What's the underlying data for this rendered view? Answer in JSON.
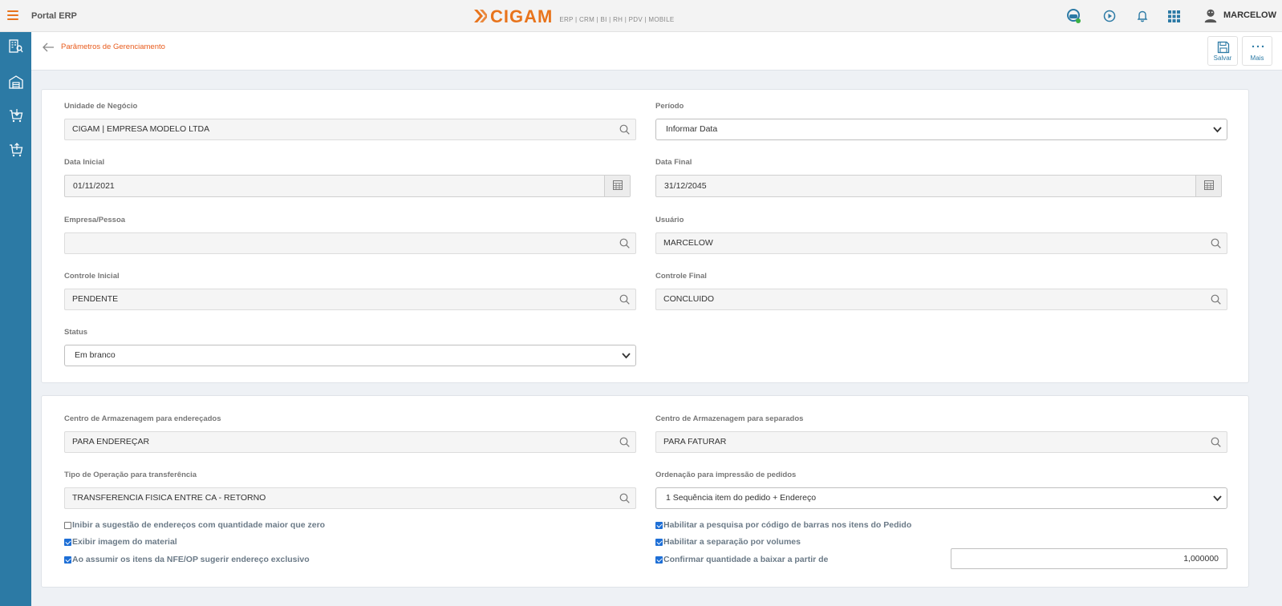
{
  "topbar": {
    "app_title": "Portal ERP",
    "logo_text": "CIGAM",
    "logo_sub": "ERP | CRM | BI | RH | PDV | MOBILE",
    "user_name": "MARCELOW",
    "brand_color": "#e8741c"
  },
  "sidebar": {
    "color": "#2c7aa5"
  },
  "header": {
    "page_title": "Parâmetros de Gerenciamento",
    "save_label": "Salvar",
    "more_label": "Mais"
  },
  "filters": {
    "unidade_label": "Unidade de Negócio",
    "unidade_value": "CIGAM | EMPRESA MODELO LTDA",
    "periodo_label": "Período",
    "periodo_value": "Informar Data",
    "data_inicial_label": "Data Inicial",
    "data_inicial_value": "01/11/2021",
    "data_final_label": "Data Final",
    "data_final_value": "31/12/2045",
    "empresa_label": "Empresa/Pessoa",
    "empresa_value": "",
    "usuario_label": "Usuário",
    "usuario_value": "MARCELOW",
    "controle_inicial_label": "Controle Inicial",
    "controle_inicial_value": "PENDENTE",
    "controle_final_label": "Controle Final",
    "controle_final_value": "CONCLUIDO",
    "status_label": "Status",
    "status_value": "Em branco"
  },
  "settings": {
    "centro_enderecados_label": "Centro de Armazenagem para endereçados",
    "centro_enderecados_value": "PARA ENDEREÇAR",
    "centro_separados_label": "Centro de Armazenagem para separados",
    "centro_separados_value": "PARA FATURAR",
    "tipo_operacao_label": "Tipo de Operação para transferência",
    "tipo_operacao_value": "TRANSFERENCIA FISICA ENTRE CA - RETORNO",
    "ordenacao_label": "Ordenação para impressão de pedidos",
    "ordenacao_value": "1 Sequência item do pedido + Endereço",
    "checks": [
      {
        "label": "Inibir a sugestão de endereços com quantidade maior que zero",
        "checked": false
      },
      {
        "label": "Exibir imagem do material",
        "checked": true
      },
      {
        "label": "Ao assumir os itens da NFE/OP sugerir endereço exclusivo",
        "checked": true
      },
      {
        "label": "Habilitar a pesquisa por código de barras nos itens do Pedido",
        "checked": true
      },
      {
        "label": "Habilitar a separação por volumes",
        "checked": true
      },
      {
        "label": "Confirmar quantidade a baixar a partir de",
        "checked": true
      }
    ],
    "quantidade_value": "1,000000"
  }
}
